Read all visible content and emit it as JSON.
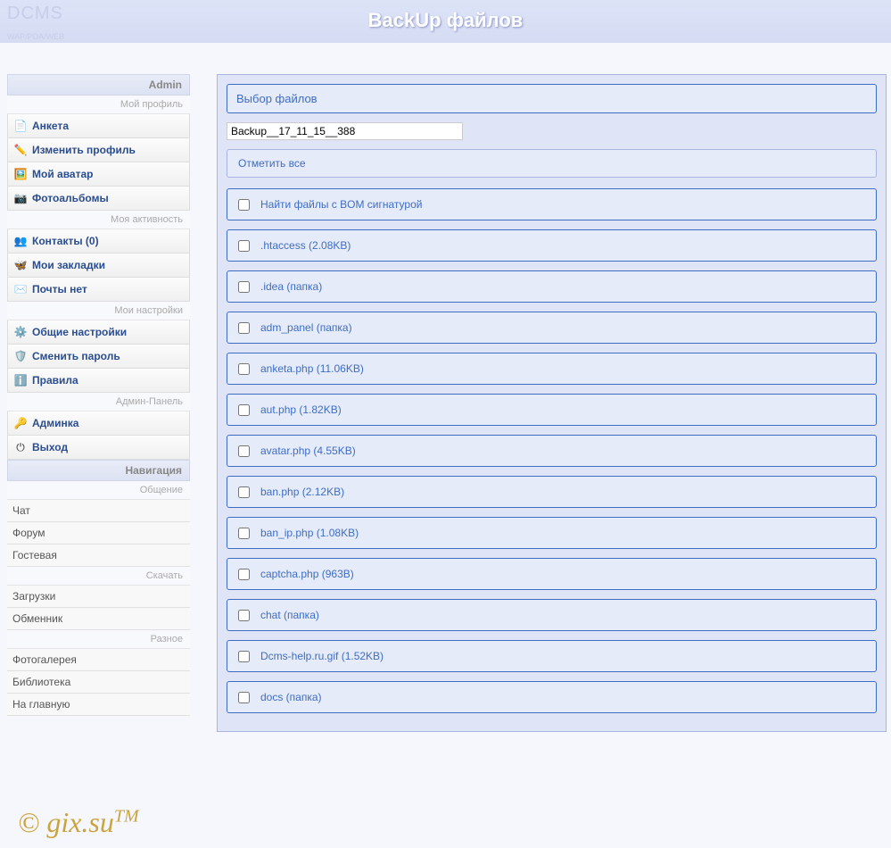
{
  "header": {
    "logo": "DCMS",
    "logo_sub": "WAP/PDA/WEB",
    "title": "BackUp файлов"
  },
  "sidebar": {
    "admin_title": "Admin",
    "groups": [
      {
        "label": "Мой профиль",
        "items": [
          {
            "icon": "📄",
            "text": "Анкета",
            "name": "anketa"
          },
          {
            "icon": "✏️",
            "text": "Изменить профиль",
            "name": "edit-profile"
          },
          {
            "icon": "🖼️",
            "text": "Мой аватар",
            "name": "my-avatar"
          },
          {
            "icon": "📷",
            "text": "Фотоальбомы",
            "name": "photo-albums"
          }
        ]
      },
      {
        "label": "Моя активность",
        "items": [
          {
            "icon": "👥",
            "text": "Контакты (0)",
            "name": "contacts"
          },
          {
            "icon": "🦋",
            "text": "Мои закладки",
            "name": "bookmarks"
          },
          {
            "icon": "✉️",
            "text": "Почты нет",
            "name": "mail"
          }
        ]
      },
      {
        "label": "Мои настройки",
        "items": [
          {
            "icon": "⚙️",
            "text": "Общие настройки",
            "name": "general-settings"
          },
          {
            "icon": "🛡️",
            "text": "Сменить пароль",
            "name": "change-password"
          },
          {
            "icon": "ℹ️",
            "text": "Правила",
            "name": "rules"
          }
        ]
      },
      {
        "label": "Админ-Панель",
        "items": [
          {
            "icon": "🔑",
            "text": "Админка",
            "name": "admin-panel"
          },
          {
            "icon": "⏻",
            "text": "Выход",
            "name": "logout"
          }
        ]
      }
    ],
    "nav_title": "Навигация",
    "nav_groups": [
      {
        "label": "Общение",
        "items": [
          {
            "text": "Чат",
            "name": "chat"
          },
          {
            "text": "Форум",
            "name": "forum"
          },
          {
            "text": "Гостевая",
            "name": "guestbook"
          }
        ]
      },
      {
        "label": "Скачать",
        "items": [
          {
            "text": "Загрузки",
            "name": "downloads"
          },
          {
            "text": "Обменник",
            "name": "exchange"
          }
        ]
      },
      {
        "label": "Разное",
        "items": [
          {
            "text": "Фотогалерея",
            "name": "gallery"
          },
          {
            "text": "Библиотека",
            "name": "library"
          },
          {
            "text": "На главную",
            "name": "home"
          }
        ]
      }
    ]
  },
  "main": {
    "select_files_title": "Выбор файлов",
    "backup_name": "Backup__17_11_15__388",
    "select_all": "Отметить все",
    "files": [
      {
        "label": "Найти файлы с BOM сигнатурой"
      },
      {
        "label": ".htaccess (2.08KB)"
      },
      {
        "label": ".idea (папка)"
      },
      {
        "label": "adm_panel (папка)"
      },
      {
        "label": "anketa.php (11.06KB)"
      },
      {
        "label": "aut.php (1.82KB)"
      },
      {
        "label": "avatar.php (4.55KB)"
      },
      {
        "label": "ban.php (2.12KB)"
      },
      {
        "label": "ban_ip.php (1.08KB)"
      },
      {
        "label": "captcha.php (963B)"
      },
      {
        "label": "chat (папка)"
      },
      {
        "label": "Dcms-help.ru.gif (1.52KB)"
      },
      {
        "label": "docs (папка)"
      }
    ]
  },
  "watermark": "© gix.su",
  "watermark_tm": "TM"
}
